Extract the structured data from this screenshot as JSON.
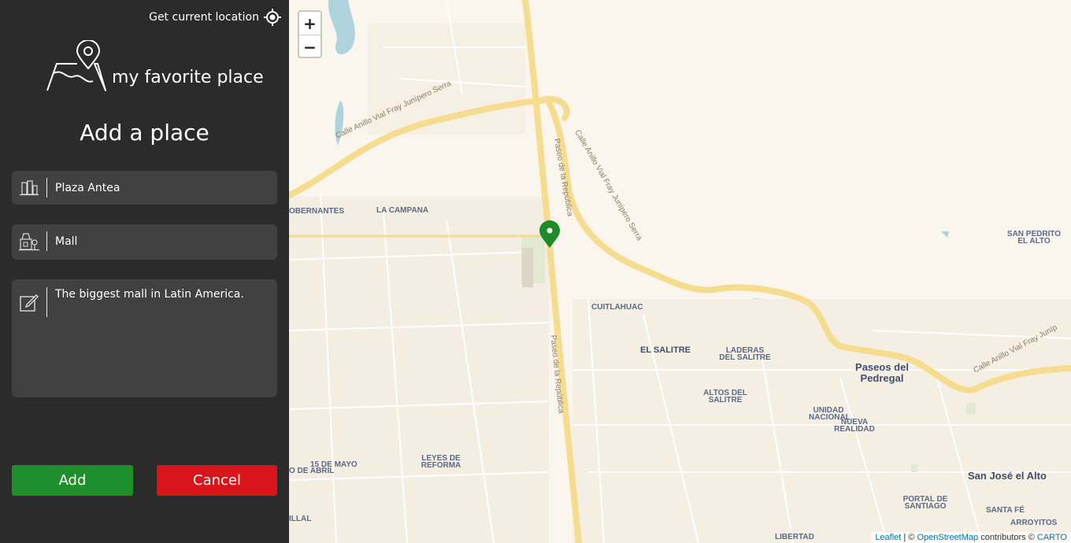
{
  "sidebar": {
    "location_label": "Get current location",
    "logo_text": "my favorite place",
    "heading": "Add a place",
    "name_value": "Plaza Antea",
    "category_value": "Mall",
    "description_value": "The biggest mall in Latin America.",
    "add_label": "Add",
    "cancel_label": "Cancel"
  },
  "map": {
    "zoom_in": "+",
    "zoom_out": "−",
    "attribution": {
      "leaflet": "Leaflet",
      "sep": " | © ",
      "osm": "OpenStreetMap",
      "contributors": " contributors © ",
      "carto": "CARTO"
    },
    "labels": {
      "gobernantes": "OBERNANTES",
      "la_campana": "LA CAMPANA",
      "cuitlahuac": "CUITLAHUAC",
      "el_salitre": "EL SALITRE",
      "laderas": "LADERAS DEL SALITRE",
      "altos": "ALTOS DEL SALITRE",
      "paseos": "Paseos del Pedregal",
      "unidad": "UNIDAD NACIONAL",
      "nueva": "NUEVA REALIDAD",
      "san_pedrito": "SAN PEDRITO EL ALTO",
      "san_jose": "San José el Alto",
      "portal": "PORTAL DE SANTIAGO",
      "santa_fe": "SANTA FÉ",
      "arroyitos": "ARROYITOS",
      "libertad": "LIBERTAD",
      "quince_mayo": "15 DE MAYO",
      "abril": "O DE ABRIL",
      "leyes": "LEYES DE REFORMA",
      "illal": "ILLAL"
    },
    "roads": {
      "anillo_left": "Calle Anillo Vial Fray Junípero Serra",
      "paseo_top": "Paseo de la República",
      "anillo_mid": "Calle Anillo Vial Fray Junípero Serra",
      "paseo_bottom": "Paseo de la República",
      "anillo_right": "Calle Anillo Vial Fray Juníp"
    }
  },
  "colors": {
    "sidebar_bg": "#2b2b2b",
    "field_bg": "#414141",
    "add_green": "#1f8f2d",
    "cancel_red": "#d9141b",
    "marker_green": "#1e8b2b",
    "road_yellow": "#f6dc8f"
  }
}
